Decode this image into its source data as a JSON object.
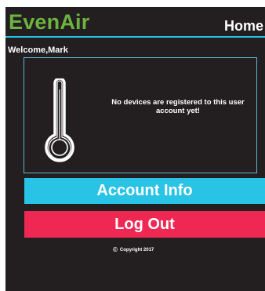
{
  "header": {
    "brand": "EvenAir",
    "page_title": "Home"
  },
  "welcome_text": "Welcome,Mark",
  "device_panel": {
    "icon": "thermometer-icon",
    "message": "No devices are registered to this user account yet!"
  },
  "buttons": {
    "account_info": "Account Info",
    "log_out": "Log Out"
  },
  "footer": {
    "copyright_symbol": "©",
    "copyright_text": "Copyright 2017"
  },
  "colors": {
    "background": "#231f20",
    "brand": "#6cb33f",
    "accent": "#29c3e6",
    "logout": "#ee2753",
    "panel_border": "#5fb6cf"
  }
}
